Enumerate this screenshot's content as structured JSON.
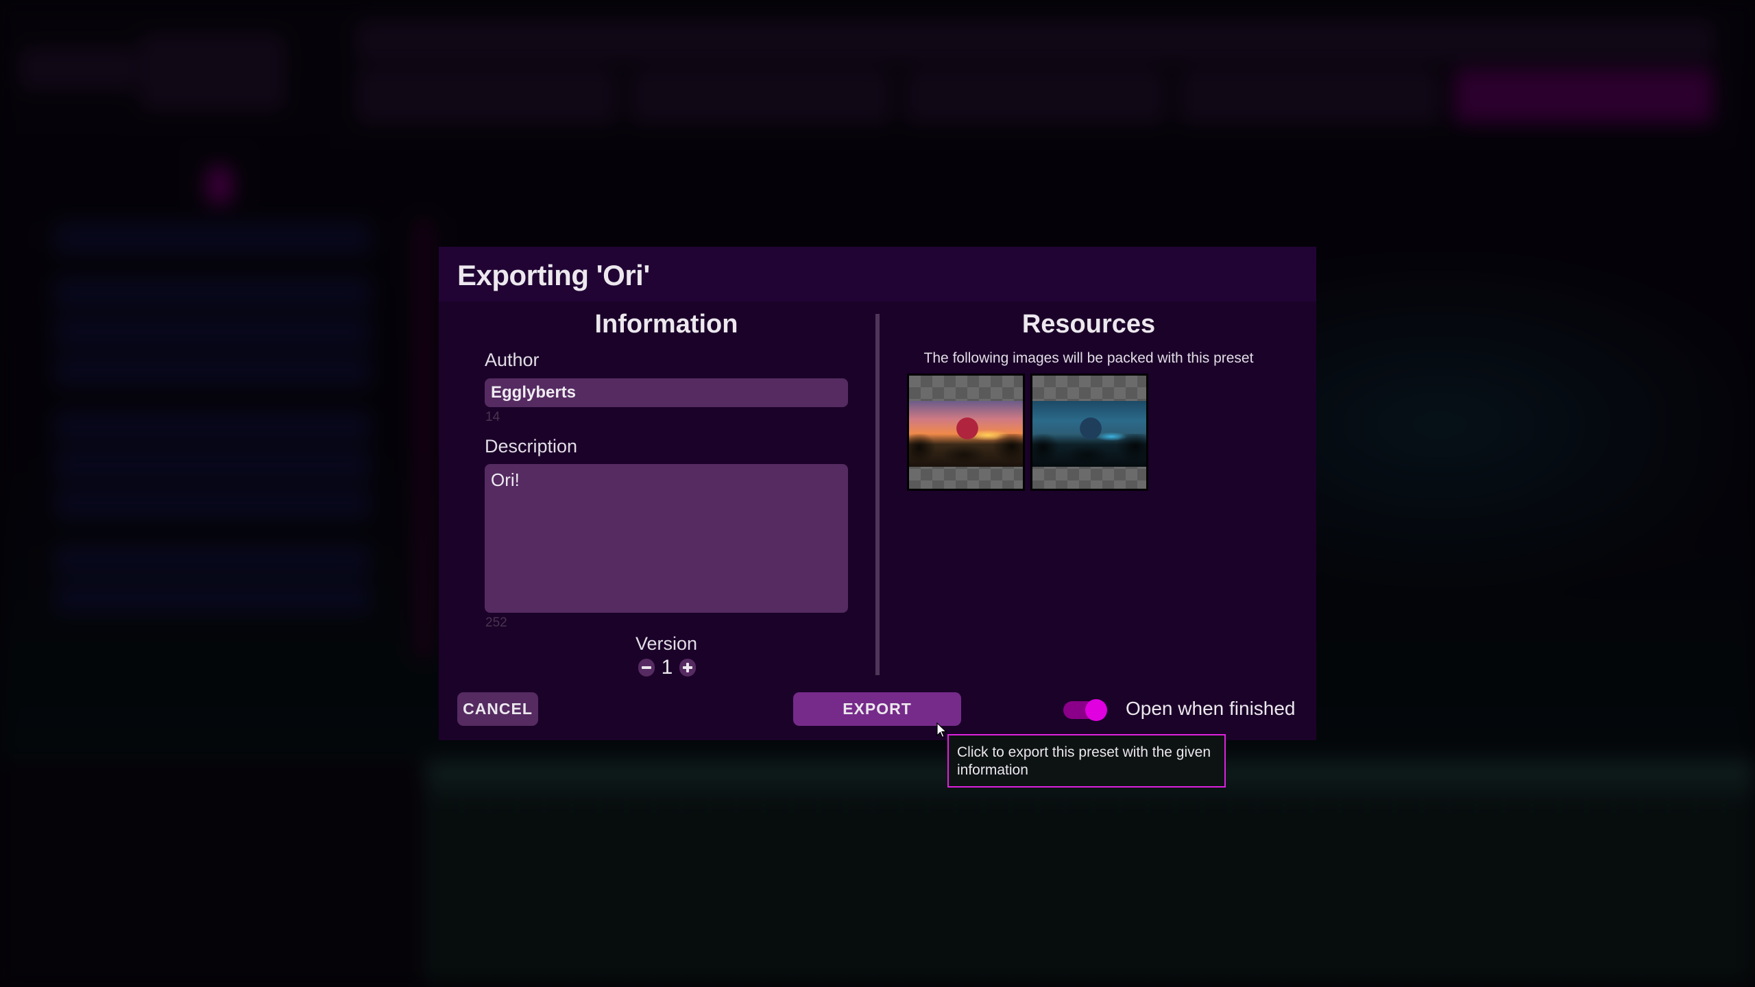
{
  "dialog": {
    "title": "Exporting 'Ori'",
    "information": {
      "heading": "Information",
      "author_label": "Author",
      "author_value": "Egglyberts",
      "author_chars_remaining": "14",
      "description_label": "Description",
      "description_value": "Ori!",
      "description_chars_remaining": "252",
      "version_label": "Version",
      "version_value": "1",
      "decrement_icon": "minus-icon",
      "increment_icon": "plus-icon"
    },
    "resources": {
      "heading": "Resources",
      "subtitle": "The following images will be packed with this preset",
      "images": [
        {
          "name": "sunset-forest-thumbnail"
        },
        {
          "name": "night-forest-thumbnail"
        }
      ]
    },
    "footer": {
      "cancel_label": "CANCEL",
      "export_label": "EXPORT",
      "open_when_finished_label": "Open when finished",
      "open_when_finished": true
    }
  },
  "tooltip": {
    "text": "Click to export this preset with the given information"
  },
  "colors": {
    "dialog_bg": "#1b0229",
    "input_bg": "#552b61",
    "export_button": "#762b8a",
    "accent": "#e000e0"
  }
}
